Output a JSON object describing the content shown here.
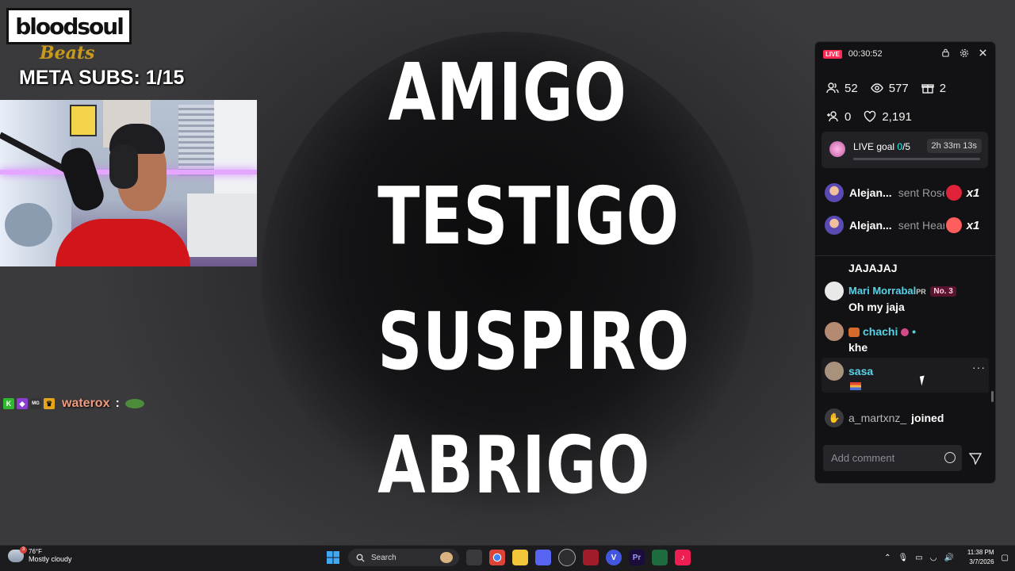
{
  "overlay": {
    "logo_text": "bloodsoul",
    "logo_sub": "Beats",
    "meta_subs": "META SUBS: 1/15"
  },
  "lyrics": [
    "AMIGO",
    "TESTIGO",
    "SUSPIRO",
    "ABRIGO"
  ],
  "left_chat": {
    "badges": [
      "K",
      "◆",
      "MG",
      "♛"
    ],
    "username": "waterox",
    "separator": ":"
  },
  "live_panel": {
    "live_label": "LIVE",
    "timer": "00:30:52",
    "stats": {
      "viewers_now": "52",
      "views": "577",
      "gifts": "2",
      "new_followers": "0",
      "likes": "2,191"
    },
    "goal": {
      "label": "LIVE goal",
      "current": "0",
      "total": "/5",
      "time_left": "2h 33m 13s",
      "progress_fraction": 0
    },
    "gift_events": [
      {
        "name": "Alejan...",
        "sent": "sent Rose",
        "multiplier": "x1",
        "gift_color": "#e0233a"
      },
      {
        "name": "Alejan...",
        "sent": "sent Heart",
        "multiplier": "x1",
        "gift_color": "#ff5e5e"
      }
    ],
    "messages": [
      {
        "name": "",
        "text": "JAJAJAJ"
      },
      {
        "name": "Mari Morrabal",
        "name_suffix": "PR",
        "rank": "No. 3",
        "text": "Oh my jaja"
      },
      {
        "name": "chachi",
        "text": "khe"
      },
      {
        "name": "sasa",
        "text": ""
      }
    ],
    "joined": {
      "name": "a_martxnz_",
      "text": "joined"
    },
    "input_placeholder": "Add comment"
  },
  "taskbar": {
    "weather_temp": "76°F",
    "weather_desc": "Mostly cloudy",
    "weather_badge": "3",
    "search_label": "Search",
    "time": "11:38 PM",
    "date": "3/7/2026"
  }
}
